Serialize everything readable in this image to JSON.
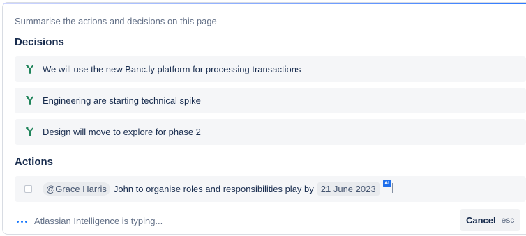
{
  "prompt": "Summarise the actions and decisions on this page",
  "decisions": {
    "title": "Decisions",
    "icon": "decision-branch-icon",
    "icon_color": "#1f845a",
    "items": [
      {
        "text": "We will use the new Banc.ly platform for processing transactions"
      },
      {
        "text": "Engineering are starting technical spike"
      },
      {
        "text": "Design will move to explore for phase 2"
      }
    ]
  },
  "actions": {
    "title": "Actions",
    "items": [
      {
        "checked": false,
        "mention": "@Grace Harris",
        "text": "John to organise roles and responsibilities play by",
        "date": "21 June 2023",
        "badge": "AI"
      }
    ]
  },
  "footer": {
    "status_text": "Atlassian Intelligence is typing...",
    "cancel_label": "Cancel",
    "cancel_shortcut": "esc",
    "accent_color": "#1d7afc"
  }
}
